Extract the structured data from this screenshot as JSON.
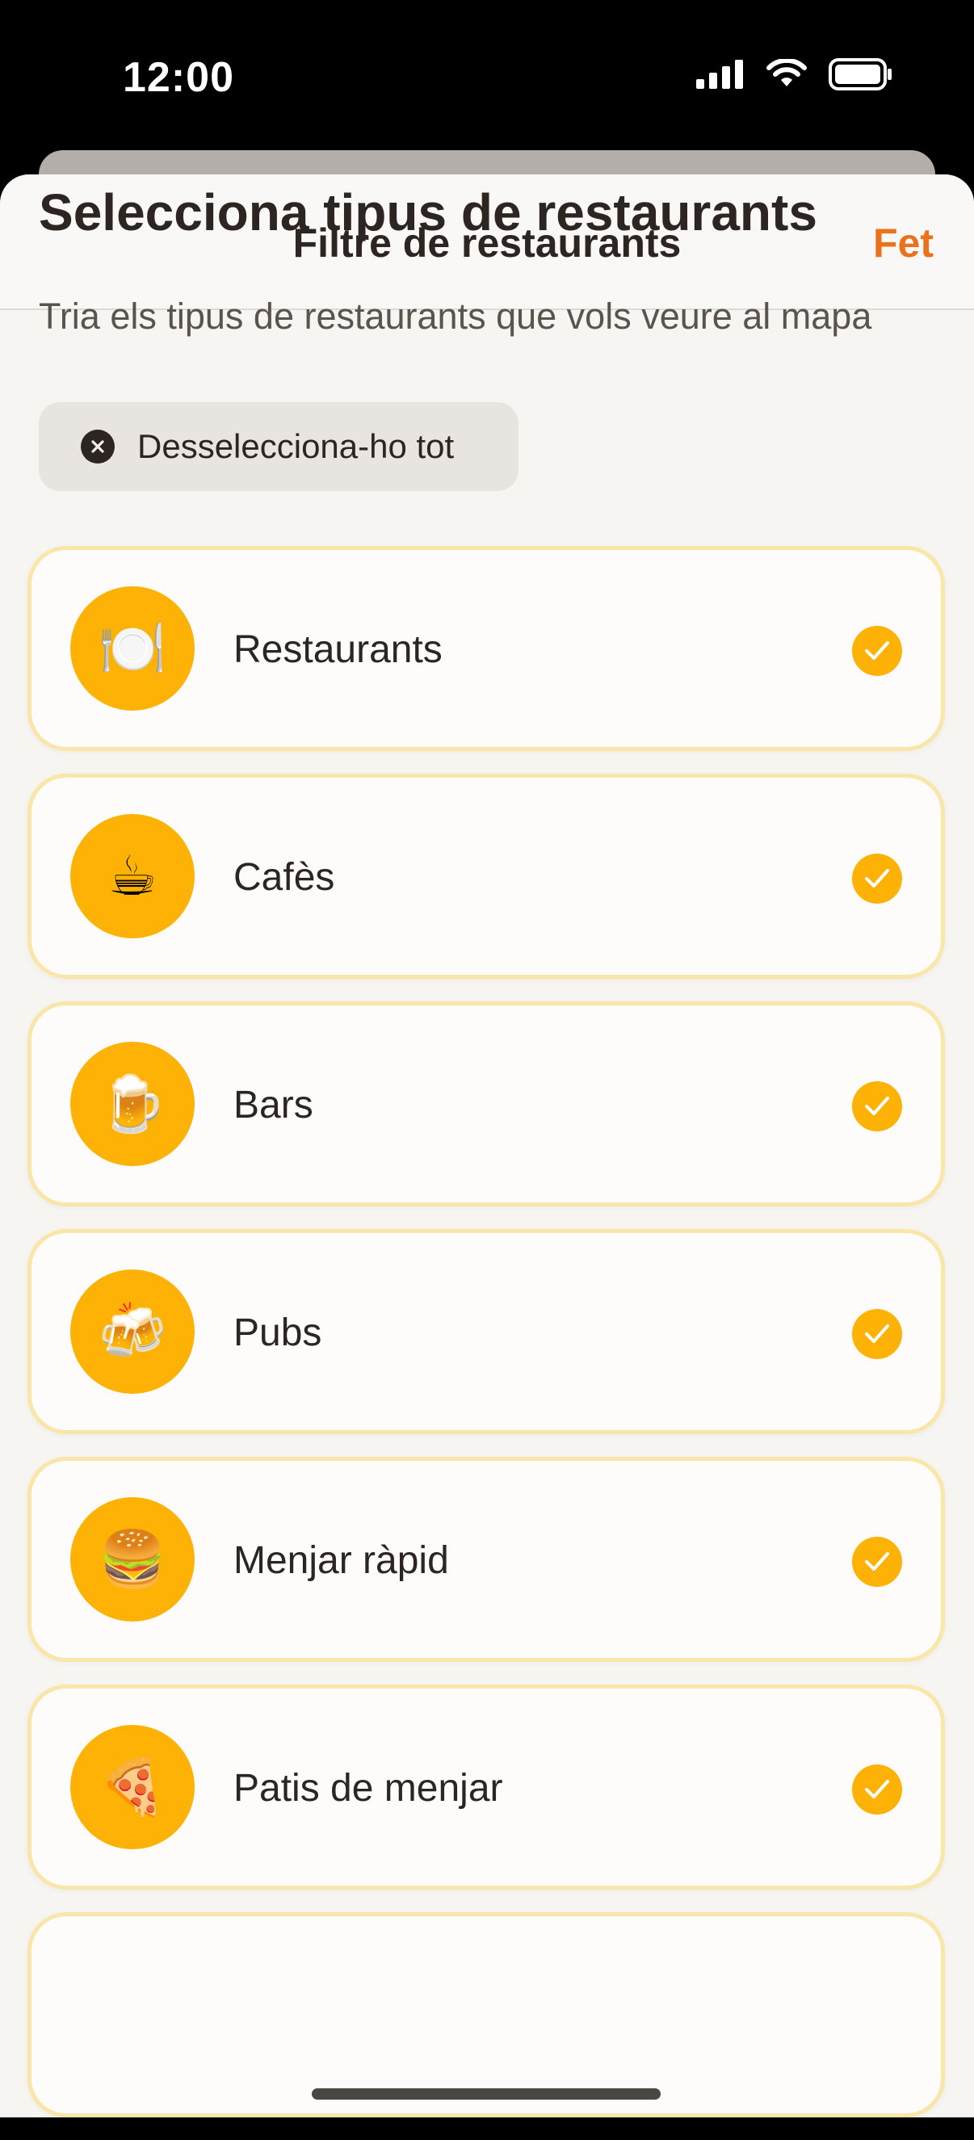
{
  "status_bar": {
    "time": "12:00"
  },
  "nav": {
    "title": "Filtre de restaurants",
    "done_label": "Fet"
  },
  "main": {
    "heading": "Selecciona tipus de restaurants",
    "subtitle": "Tria els tipus de restaurants que vols veure al mapa",
    "deselect_label": "Desselecciona-ho tot"
  },
  "categories": [
    {
      "label": "Restaurants",
      "emoji": "🍽️",
      "selected": true
    },
    {
      "label": "Cafès",
      "emoji": "☕",
      "selected": true
    },
    {
      "label": "Bars",
      "emoji": "🍺",
      "selected": true
    },
    {
      "label": "Pubs",
      "emoji": "🍻",
      "selected": true
    },
    {
      "label": "Menjar ràpid",
      "emoji": "🍔",
      "selected": true
    },
    {
      "label": "Patis de menjar",
      "emoji": "🍕",
      "selected": true
    }
  ],
  "colors": {
    "accent": "#e8731c",
    "icon_bg": "#fdb205",
    "card_border": "#fae6a8"
  }
}
